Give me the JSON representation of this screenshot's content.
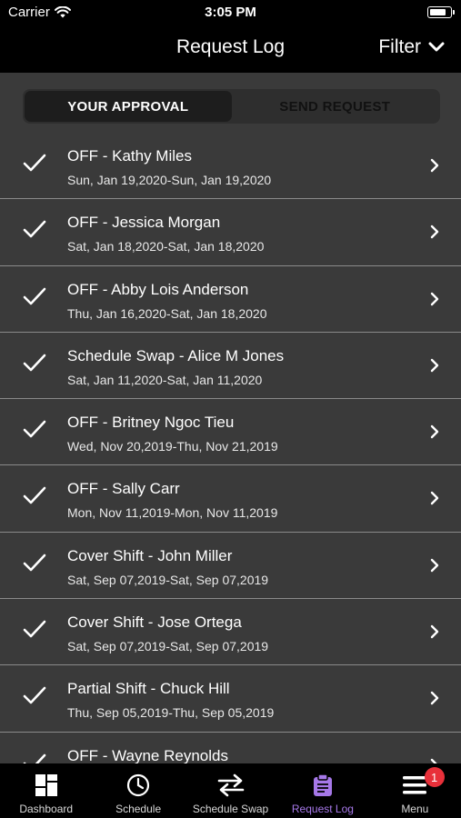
{
  "status_bar": {
    "carrier": "Carrier",
    "time": "3:05 PM",
    "battery_level": 0.85
  },
  "nav": {
    "title": "Request Log",
    "filter_label": "Filter",
    "filter_icon": "chevron-down-icon"
  },
  "segments": {
    "active": "YOUR APPROVAL",
    "inactive": "SEND REQUEST"
  },
  "requests": [
    {
      "title": "OFF - Kathy Miles",
      "dates": "Sun, Jan 19,2020-Sun, Jan 19,2020"
    },
    {
      "title": "OFF - Jessica Morgan",
      "dates": "Sat, Jan 18,2020-Sat, Jan 18,2020"
    },
    {
      "title": "OFF - Abby Lois Anderson",
      "dates": "Thu, Jan 16,2020-Sat, Jan 18,2020"
    },
    {
      "title": "Schedule Swap - Alice M Jones",
      "dates": "Sat, Jan 11,2020-Sat, Jan 11,2020"
    },
    {
      "title": "OFF - Britney Ngoc Tieu",
      "dates": "Wed, Nov 20,2019-Thu, Nov 21,2019"
    },
    {
      "title": "OFF - Sally Carr",
      "dates": "Mon, Nov 11,2019-Mon, Nov 11,2019"
    },
    {
      "title": "Cover Shift - John Miller",
      "dates": "Sat, Sep 07,2019-Sat, Sep 07,2019"
    },
    {
      "title": "Cover Shift - Jose Ortega",
      "dates": "Sat, Sep 07,2019-Sat, Sep 07,2019"
    },
    {
      "title": "Partial Shift - Chuck Hill",
      "dates": "Thu, Sep 05,2019-Thu, Sep 05,2019"
    },
    {
      "title": "OFF - Wayne Reynolds",
      "dates": ""
    }
  ],
  "tabs": [
    {
      "label": "Dashboard",
      "icon": "dashboard-icon"
    },
    {
      "label": "Schedule",
      "icon": "clock-icon"
    },
    {
      "label": "Schedule Swap",
      "icon": "swap-icon"
    },
    {
      "label": "Request Log",
      "icon": "clipboard-icon",
      "active": true
    },
    {
      "label": "Menu",
      "icon": "menu-icon",
      "badge": "1"
    }
  ],
  "colors": {
    "accent": "#a678e8",
    "fab": "#ec5f83",
    "badge": "#e8303a",
    "list_background": "#3a3a3a"
  }
}
